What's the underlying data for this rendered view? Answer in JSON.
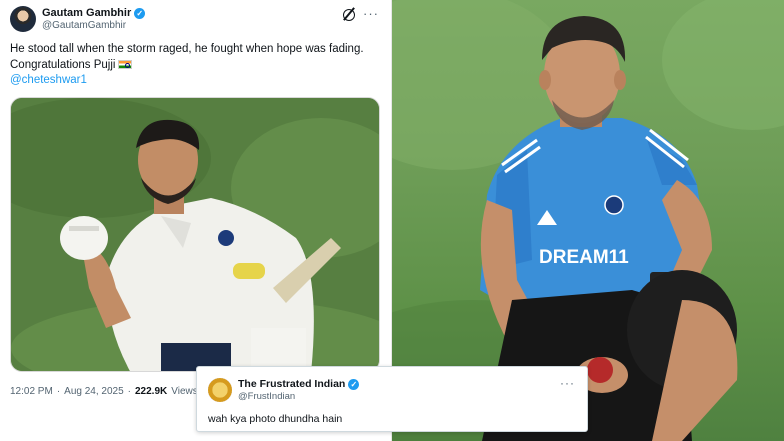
{
  "tweet": {
    "author_name": "Gautam Gambhir",
    "author_handle": "@GautamGambhir",
    "text_line1": "He stood tall when the storm raged, he fought when hope was fading.",
    "text_line2": "Congratulations Pujji",
    "mention": "@cheteshwar1",
    "time": "12:02 PM",
    "separator": "·",
    "date": "Aug 24, 2025",
    "separator2": "·",
    "views_count": "222.9K",
    "views_label": "Views",
    "more_glyph": "···",
    "verified_glyph": "✓"
  },
  "reply": {
    "author_name": "The Frustrated Indian",
    "author_handle": "@FrustIndian",
    "text": "wah kya photo dhundha hain",
    "more_glyph": "···",
    "verified_glyph": "✓"
  },
  "colors": {
    "accent": "#1d9bf0",
    "text": "#0f1419",
    "muted": "#536471"
  }
}
